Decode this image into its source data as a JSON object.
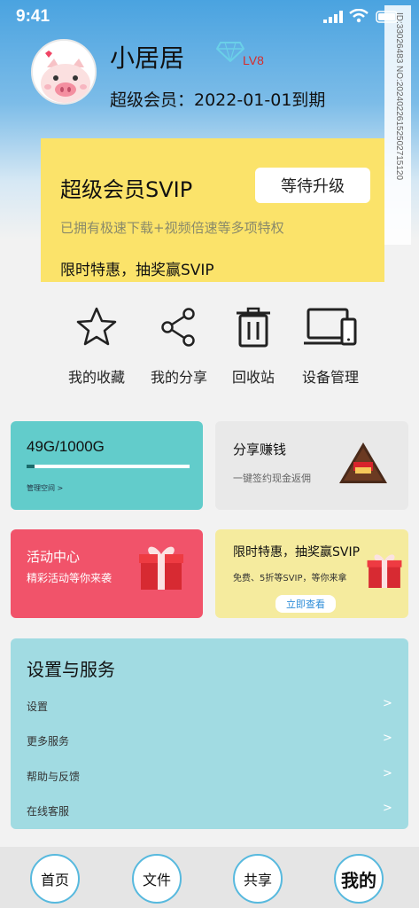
{
  "status_bar": {
    "time": "9:41"
  },
  "watermark": "ID:33026483 NO:20240226152502715120",
  "profile": {
    "name": "小居居",
    "vip_level": "LV8",
    "expire_text": "超级会员：2022-01-01到期"
  },
  "svip_card": {
    "title": "超级会员SVIP",
    "button": "等待升级",
    "description": "已拥有极速下载+视频倍速等多项特权",
    "promo": "限时特惠，抽奖赢SVIP"
  },
  "quick_actions": [
    {
      "label": "我的收藏",
      "icon": "star-icon"
    },
    {
      "label": "我的分享",
      "icon": "share-icon"
    },
    {
      "label": "回收站",
      "icon": "trash-icon"
    },
    {
      "label": "设备管理",
      "icon": "devices-icon"
    }
  ],
  "storage": {
    "text": "49G/1000G",
    "used_fraction": 0.049,
    "link": "管理空间 >"
  },
  "share_earn": {
    "title": "分享赚钱",
    "description": "一键签约现金返佣",
    "badge_icon": "earn-badge-icon"
  },
  "activity": {
    "title": "活动中心",
    "description": "精彩活动等你来袭"
  },
  "promo": {
    "title": "限时特惠，抽奖赢SVIP",
    "description": "免费、5折等SVIP，等你来拿",
    "button": "立即查看"
  },
  "settings": {
    "title": "设置与服务",
    "items": [
      {
        "label": "设置",
        "chevron": ">"
      },
      {
        "label": "更多服务",
        "chevron": ">"
      },
      {
        "label": "帮助与反馈",
        "chevron": ">"
      },
      {
        "label": "在线客服",
        "chevron": ">"
      }
    ]
  },
  "bottom_nav": {
    "items": [
      "首页",
      "文件",
      "共享",
      "我的"
    ],
    "active": "我的"
  },
  "colors": {
    "accent": "#57b9de",
    "svip_yellow": "#fbe36a",
    "storage_teal": "#62cccb",
    "activity_red": "#f1536a",
    "settings_blue": "#a1dbe2"
  }
}
